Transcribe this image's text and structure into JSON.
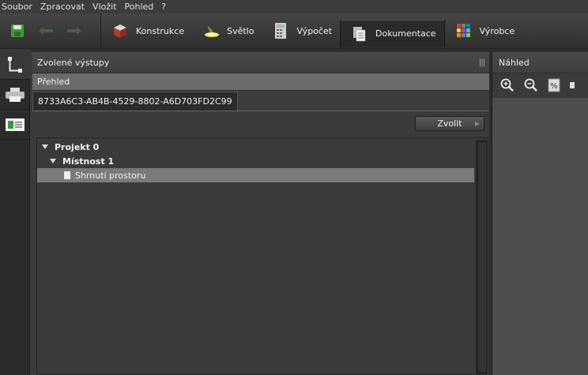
{
  "menu": [
    "Soubor",
    "Zpracovat",
    "Vložit",
    "Pohled",
    "?"
  ],
  "toolbar": {
    "save_icon": "save-icon",
    "undo_icon": "undo-icon",
    "redo_icon": "redo-icon",
    "tabs": [
      {
        "label": "Konstrukce",
        "icon": "construction-icon"
      },
      {
        "label": "Světlo",
        "icon": "light-icon"
      },
      {
        "label": "Výpočet",
        "icon": "calculator-icon"
      },
      {
        "label": "Dokumentace",
        "icon": "documents-icon",
        "active": true
      },
      {
        "label": "Výrobce",
        "icon": "manufacturer-icon"
      }
    ]
  },
  "left_strip": [
    {
      "icon": "tree-structure-icon",
      "active": true
    },
    {
      "icon": "printer-icon"
    },
    {
      "icon": "id-card-icon"
    }
  ],
  "center_panel": {
    "title": "Zvolené výstupy",
    "section": "Přehled",
    "doc_tab": "8733A6C3-AB4B-4529-8802-A6D703FD2C99",
    "select_button": "Zvolit",
    "tree": [
      {
        "label": "Projekt 0",
        "level": 0,
        "expanded": true
      },
      {
        "label": "Místnost 1",
        "level": 1,
        "expanded": true
      },
      {
        "label": "Shrnutí prostoru",
        "level": 2,
        "selected": true
      }
    ]
  },
  "right_panel": {
    "title": "Náhled",
    "tools": [
      "zoom-in-icon",
      "zoom-out-icon",
      "percent-icon"
    ]
  }
}
